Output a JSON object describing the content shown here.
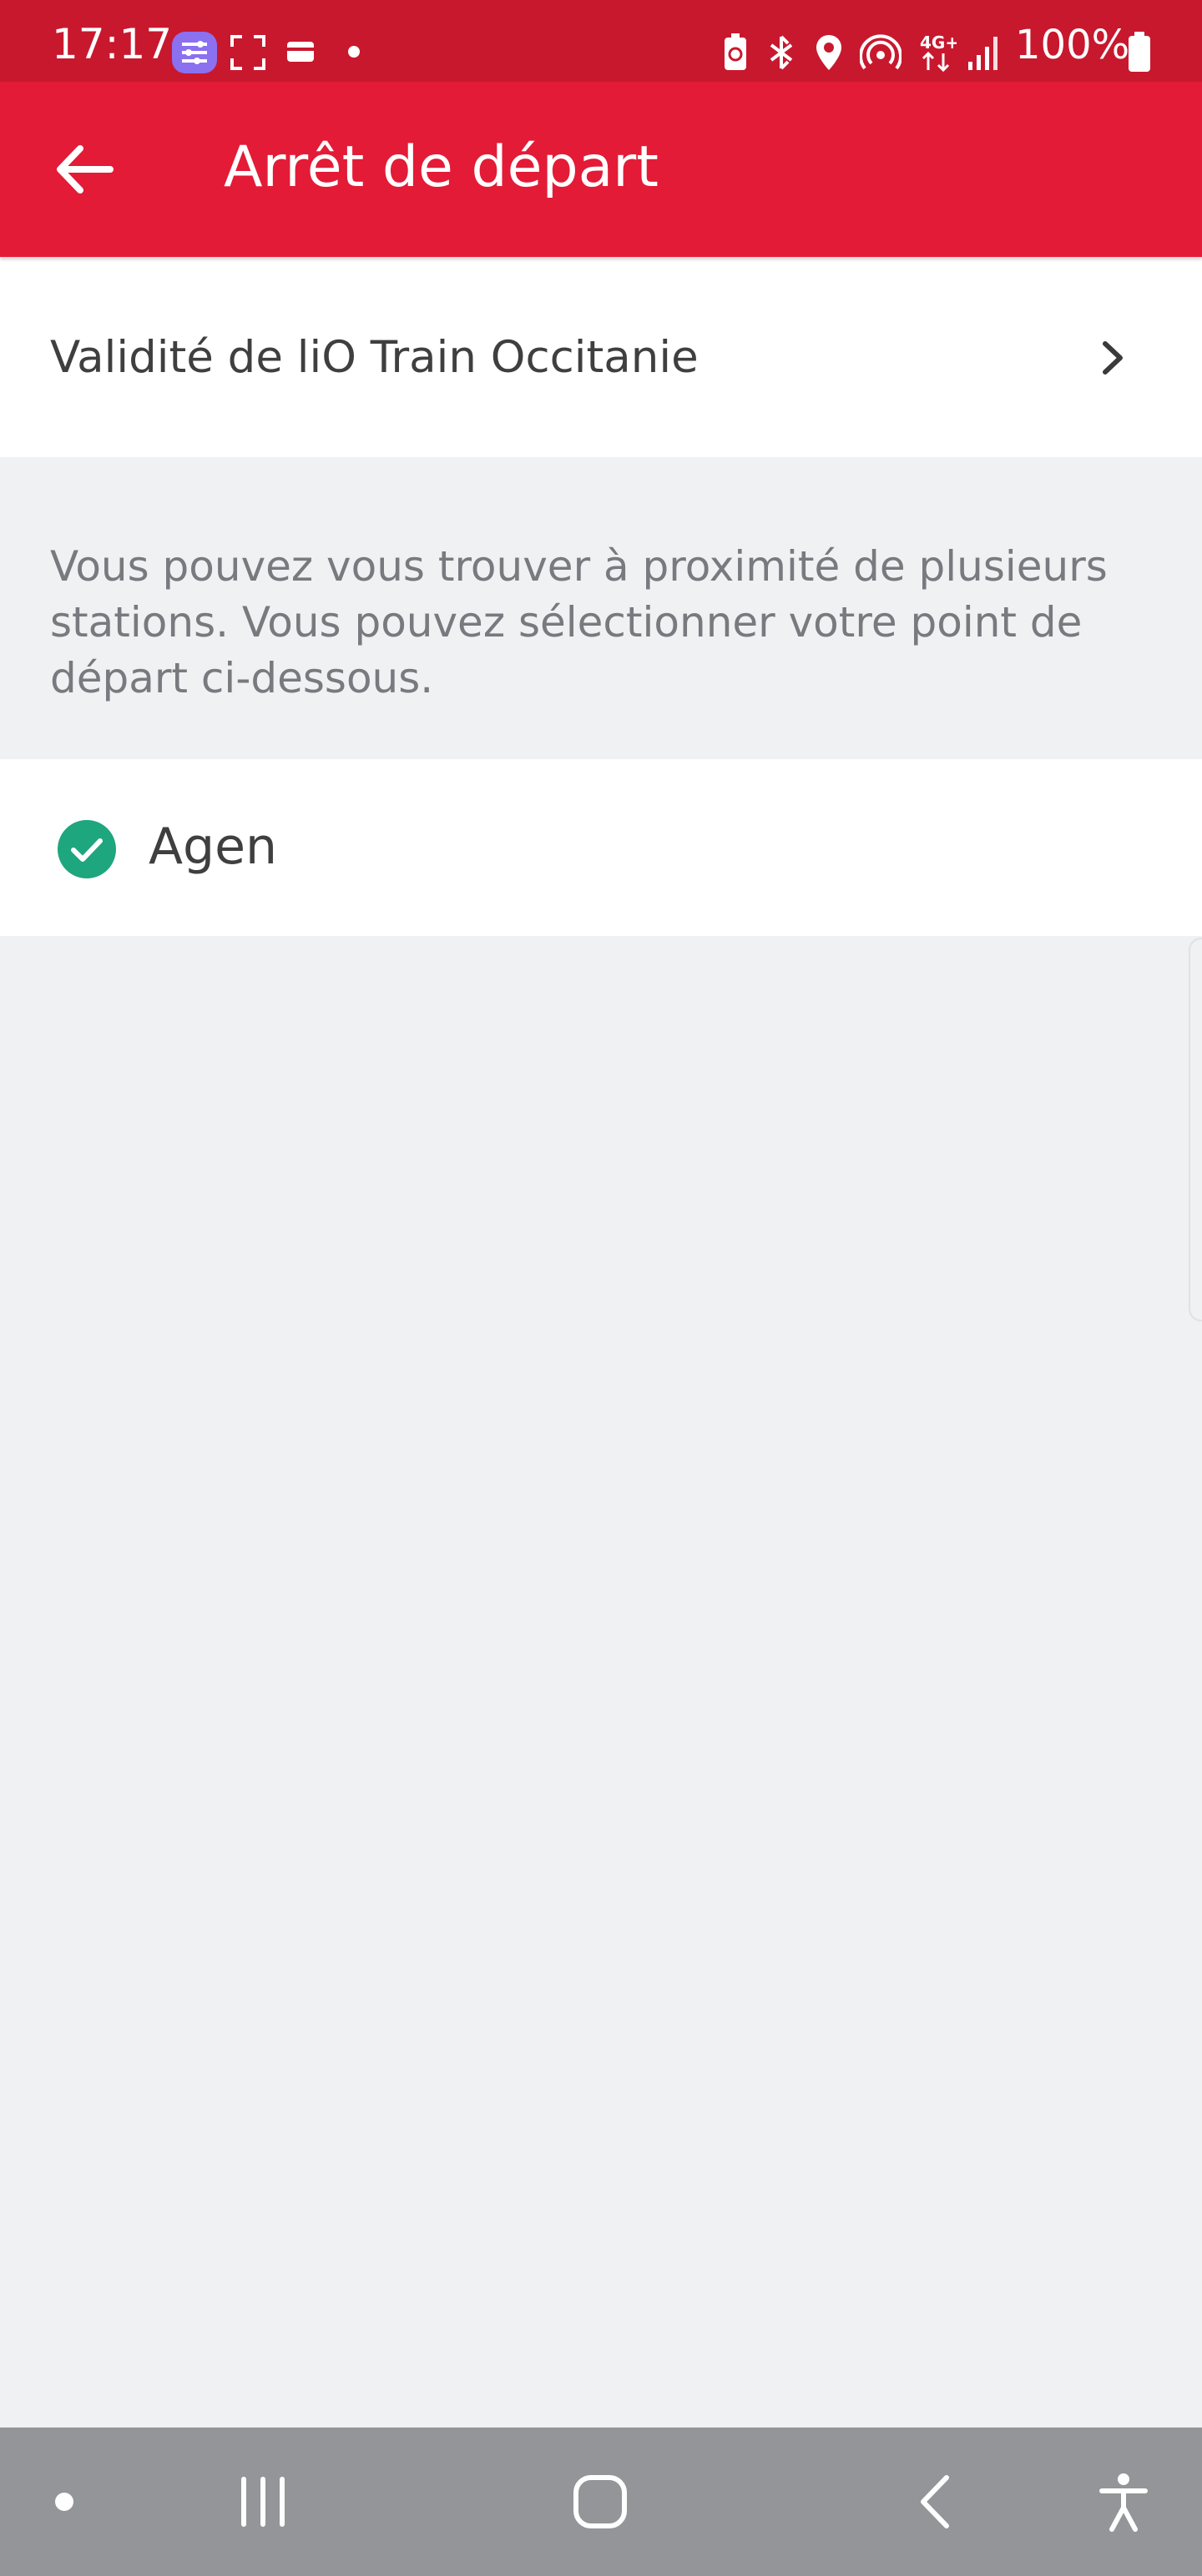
{
  "status_bar": {
    "time": "17:17",
    "battery": "100%",
    "network": "4G+",
    "icons": [
      "app-notification-icon",
      "screenshot-icon",
      "wallet-icon",
      "dot-icon",
      "battery-saver-icon",
      "bluetooth-icon",
      "location-icon",
      "hotspot-icon",
      "network-type-icon",
      "signal-icon",
      "battery-icon"
    ]
  },
  "app_bar": {
    "title": "Arrêt de départ",
    "back_icon": "arrow-left-icon",
    "color": "#e31b37"
  },
  "validity": {
    "label": "Validité de liO Train Occitanie",
    "icon": "chevron-right-icon"
  },
  "info": {
    "text": "Vous pouvez vous trouver à proximité de plusieurs stations. Vous pouvez sélectionner votre point de départ ci-dessous."
  },
  "stations": [
    {
      "name": "Agen",
      "selected": true,
      "icon": "check-circle-icon",
      "accent": "#1ea67e"
    }
  ],
  "nav_bar": {
    "buttons": [
      "dot-icon",
      "recents-icon",
      "home-icon",
      "back-icon",
      "accessibility-icon"
    ]
  }
}
